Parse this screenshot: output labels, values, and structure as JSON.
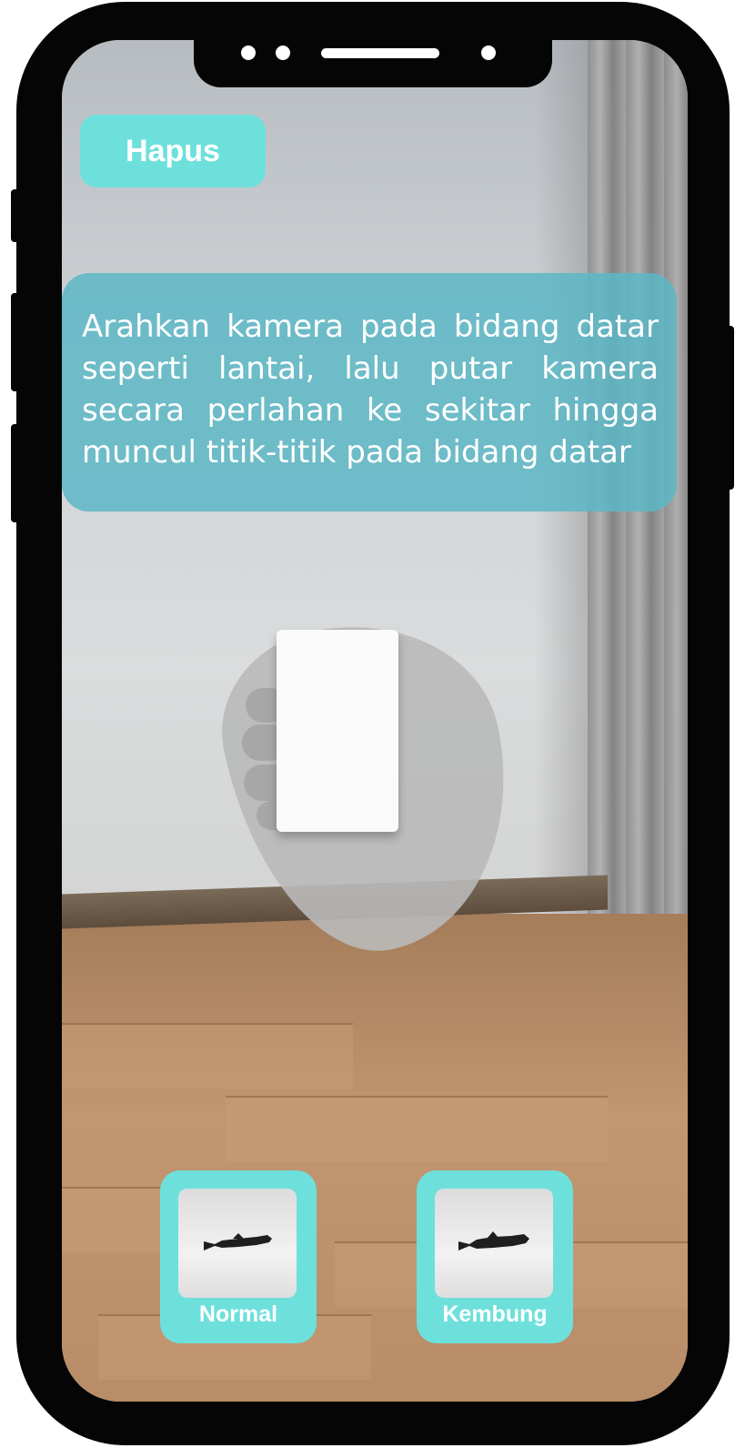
{
  "toolbar": {
    "delete_label": "Hapus"
  },
  "instruction": {
    "text": "Arahkan kamera pada bidang datar seperti lantai, lalu putar kamera secara perlahan ke sekitar hingga muncul titik-titik pada bidang datar"
  },
  "models": [
    {
      "label": "Normal",
      "icon": "fish-model-icon"
    },
    {
      "label": "Kembung",
      "icon": "fish-model-icon"
    }
  ],
  "colors": {
    "accent": "#6ee0dc",
    "instruction_bg": "#5cb7c6",
    "device_frame": "#050505"
  }
}
